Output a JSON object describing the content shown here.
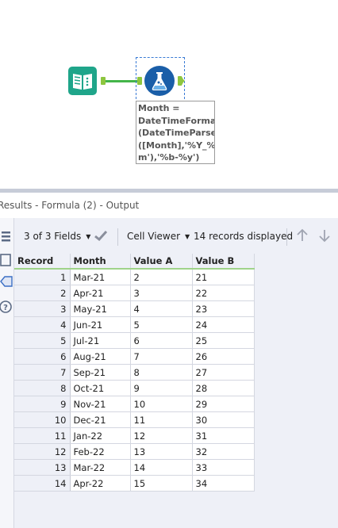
{
  "workflow": {
    "annotation": "Month =\nDateTimeFormat\n(DateTimeParse\n([Month],'%Y_%\nm'),'%b-%y')"
  },
  "results": {
    "title": "Results - Formula (2) - Output",
    "fields_label": "3 of 3 Fields",
    "viewer_label": "Cell Viewer",
    "records_label": "14 records displayed"
  },
  "table": {
    "headers": [
      "Record",
      "Month",
      "Value A",
      "Value B"
    ],
    "rows": [
      [
        "1",
        "Mar-21",
        "2",
        "21"
      ],
      [
        "2",
        "Apr-21",
        "3",
        "22"
      ],
      [
        "3",
        "May-21",
        "4",
        "23"
      ],
      [
        "4",
        "Jun-21",
        "5",
        "24"
      ],
      [
        "5",
        "Jul-21",
        "6",
        "25"
      ],
      [
        "6",
        "Aug-21",
        "7",
        "26"
      ],
      [
        "7",
        "Sep-21",
        "8",
        "27"
      ],
      [
        "8",
        "Oct-21",
        "9",
        "28"
      ],
      [
        "9",
        "Nov-21",
        "10",
        "29"
      ],
      [
        "10",
        "Dec-21",
        "11",
        "30"
      ],
      [
        "11",
        "Jan-22",
        "12",
        "31"
      ],
      [
        "12",
        "Feb-22",
        "13",
        "32"
      ],
      [
        "13",
        "Mar-22",
        "14",
        "33"
      ],
      [
        "14",
        "Apr-22",
        "15",
        "34"
      ]
    ]
  },
  "colors": {
    "input_tool": "#1fa58a",
    "formula_tool": "#1a5ea8",
    "connector": "#44b549",
    "anchor": "#8dc63f",
    "header_underline": "#9fd38a"
  },
  "icons": [
    "input-data-tool-icon",
    "formula-tool-icon",
    "checkmark-icon",
    "arrow-up-icon",
    "arrow-down-icon",
    "help-icon"
  ]
}
